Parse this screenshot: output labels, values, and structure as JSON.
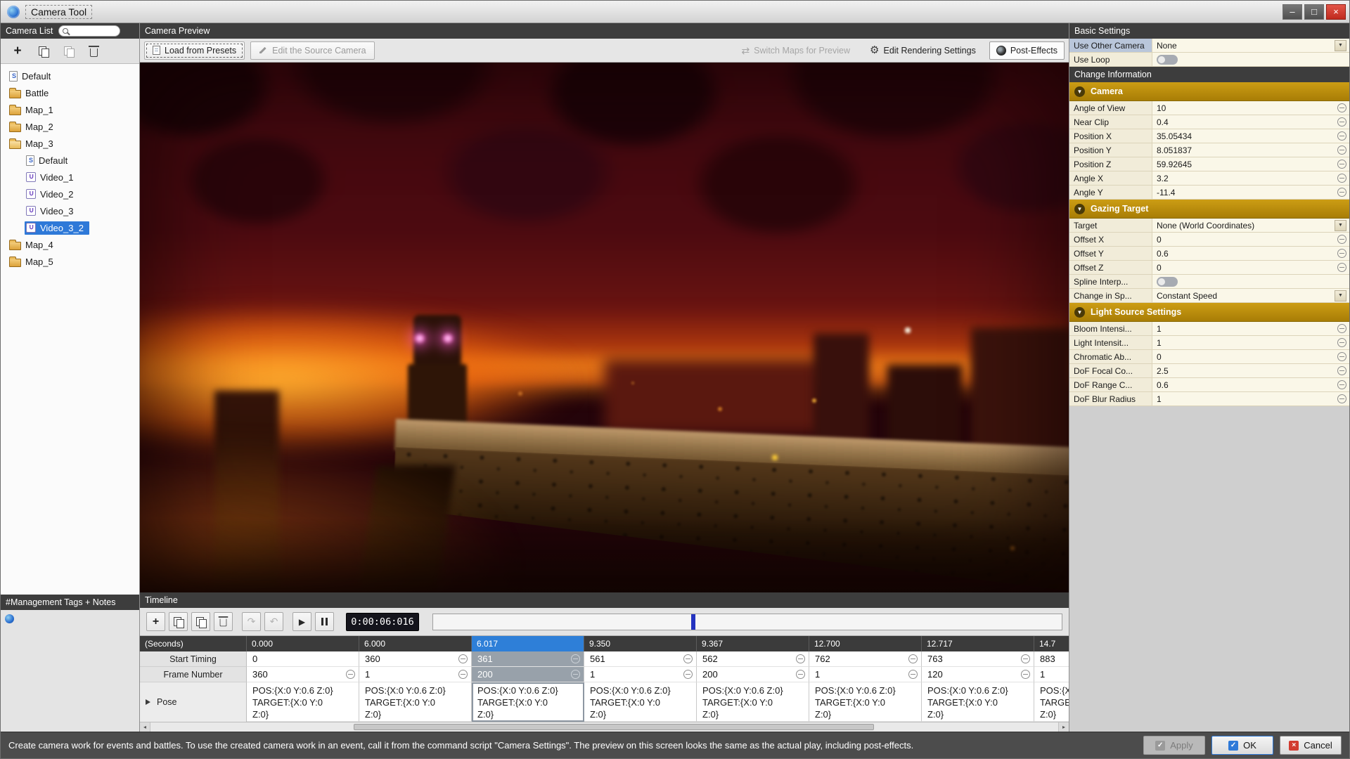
{
  "window": {
    "title": "Camera Tool",
    "minimize_glyph": "–",
    "maximize_glyph": "□",
    "close_glyph": "×"
  },
  "colors": {
    "selection_blue": "#2e79d8",
    "gold_header": "#b8860b",
    "playhead_blue": "#2433c0",
    "close_red": "#d23b2f",
    "eye_glow_pink": "#ff6fd6"
  },
  "camera_list": {
    "header": "Camera List",
    "tags_header": "#Management Tags + Notes",
    "items": [
      {
        "label": "Default"
      },
      {
        "label": "Battle"
      },
      {
        "label": "Map_1"
      },
      {
        "label": "Map_2"
      },
      {
        "label": "Map_3"
      },
      {
        "label": "Default"
      },
      {
        "label": "Video_1"
      },
      {
        "label": "Video_2"
      },
      {
        "label": "Video_3"
      },
      {
        "label": "Video_3_2"
      },
      {
        "label": "Map_4"
      },
      {
        "label": "Map_5"
      }
    ]
  },
  "preview": {
    "header": "Camera Preview",
    "load_presets": "Load from Presets",
    "edit_source": "Edit the Source Camera",
    "switch_maps": "Switch Maps for Preview",
    "edit_rendering": "Edit Rendering Settings",
    "post_effects": "Post-Effects"
  },
  "timeline": {
    "header": "Timeline",
    "time_display": "0:00:06:016",
    "seconds_label": "(Seconds)",
    "start_label": "Start Timing",
    "frame_label": "Frame Number",
    "pose_label": "Pose",
    "pose_text": "POS:{X:0 Y:0.6 Z:0}\nTARGET:{X:0 Y:0\nZ:0}",
    "columns": [
      {
        "time": "0.000",
        "start": "0",
        "frame": "360"
      },
      {
        "time": "6.000",
        "start": "360",
        "frame": "1"
      },
      {
        "time": "6.017",
        "start": "361",
        "frame": "200"
      },
      {
        "time": "9.350",
        "start": "561",
        "frame": "1"
      },
      {
        "time": "9.367",
        "start": "562",
        "frame": "200"
      },
      {
        "time": "12.700",
        "start": "762",
        "frame": "1"
      },
      {
        "time": "12.717",
        "start": "763",
        "frame": "120"
      },
      {
        "time": "14.7",
        "start": "883",
        "frame": "1"
      }
    ]
  },
  "settings": {
    "header": "Basic Settings",
    "change_info_header": "Change Information",
    "top_rows": [
      {
        "label": "Use Other Camera",
        "value": "None"
      },
      {
        "label": "Use Loop"
      }
    ],
    "sections": [
      {
        "title": "Camera",
        "rows": [
          {
            "label": "Angle of View",
            "value": "10"
          },
          {
            "label": "Near Clip",
            "value": "0.4"
          },
          {
            "label": "Position X",
            "value": "35.05434"
          },
          {
            "label": "Position Y",
            "value": "8.051837"
          },
          {
            "label": "Position Z",
            "value": "59.92645"
          },
          {
            "label": "Angle X",
            "value": "3.2"
          },
          {
            "label": "Angle Y",
            "value": "-11.4"
          }
        ]
      },
      {
        "title": "Gazing Target",
        "rows": [
          {
            "label": "Target",
            "value": "None (World Coordinates)"
          },
          {
            "label": "Offset X",
            "value": "0"
          },
          {
            "label": "Offset Y",
            "value": "0.6"
          },
          {
            "label": "Offset Z",
            "value": "0"
          },
          {
            "label": "Spline Interp...",
            "value": ""
          },
          {
            "label": "Change in Sp...",
            "value": "Constant Speed"
          }
        ]
      },
      {
        "title": "Light Source Settings",
        "rows": [
          {
            "label": "Bloom Intensi...",
            "value": "1"
          },
          {
            "label": "Light Intensit...",
            "value": "1"
          },
          {
            "label": "Chromatic Ab...",
            "value": "0"
          },
          {
            "label": "DoF Focal Co...",
            "value": "2.5"
          },
          {
            "label": "DoF Range C...",
            "value": "0.6"
          },
          {
            "label": "DoF Blur Radius",
            "value": "1"
          }
        ]
      }
    ]
  },
  "statusbar": {
    "message": "Create camera work for events and battles. To use the created camera work in an event, call it from the command script \"Camera Settings\". The preview on this screen looks the same as the actual play, including post-effects.",
    "apply": "Apply",
    "ok": "OK",
    "cancel": "Cancel"
  }
}
